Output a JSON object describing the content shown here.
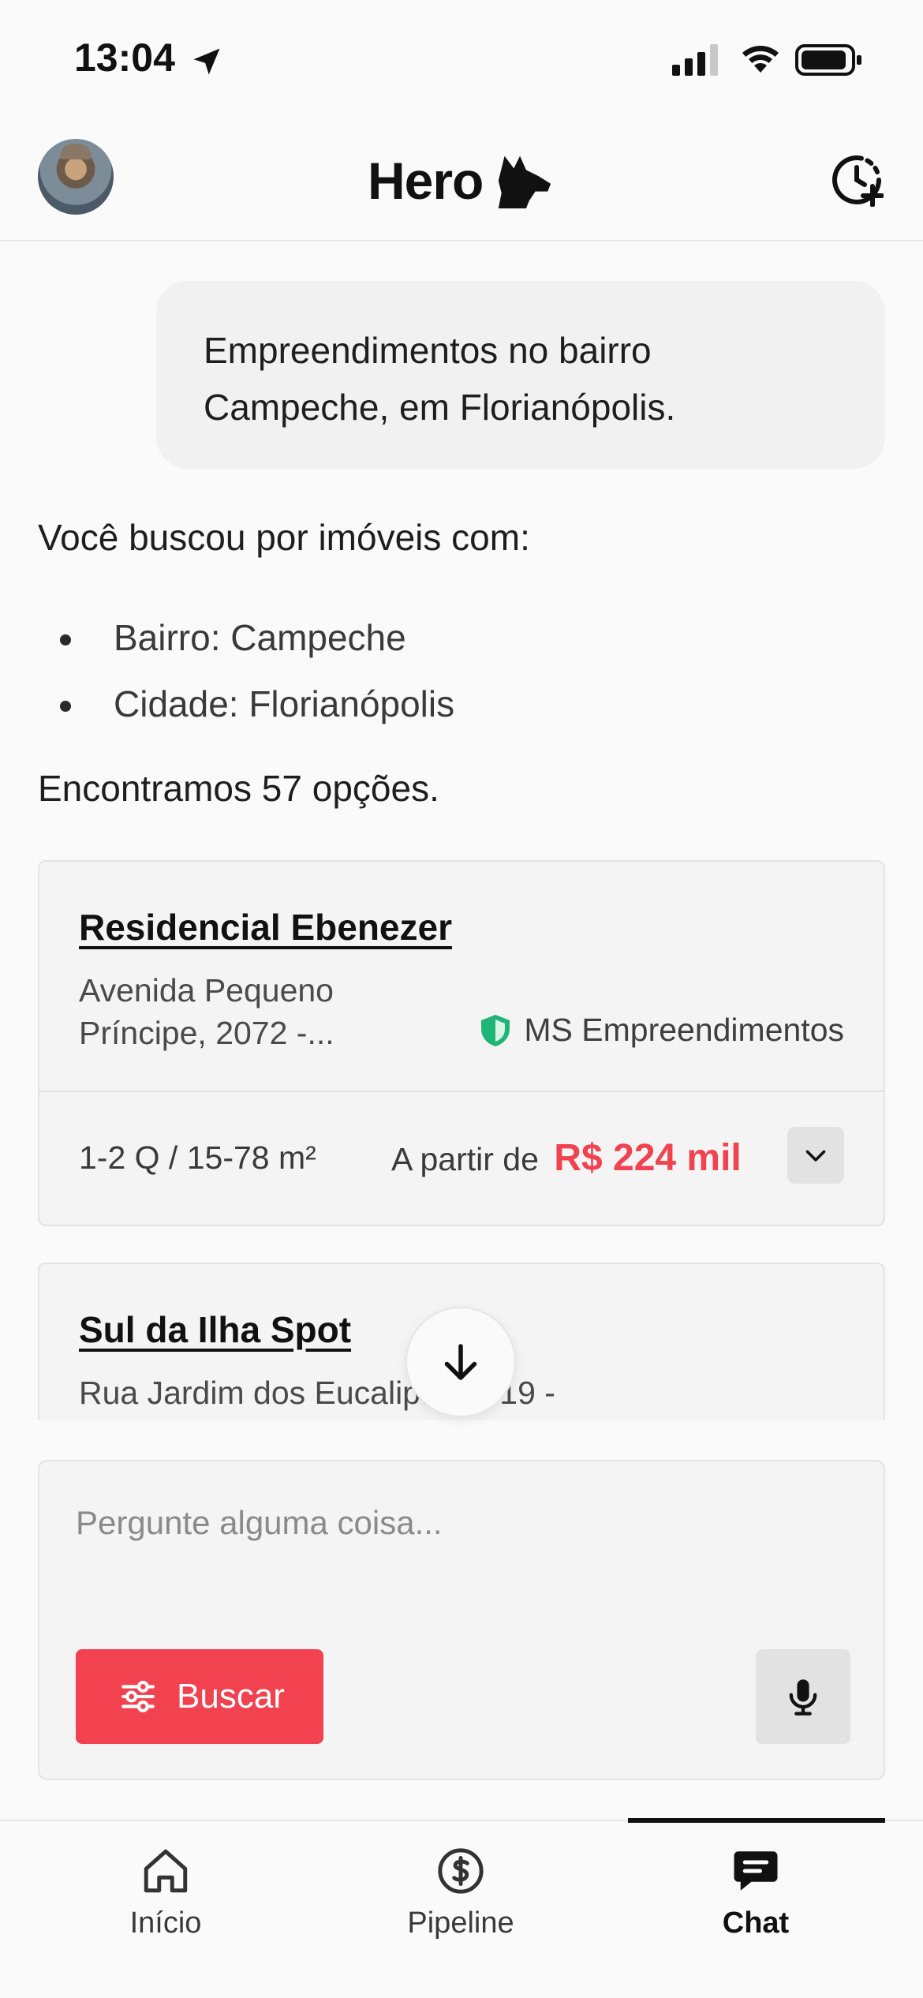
{
  "status_bar": {
    "time": "13:04"
  },
  "header": {
    "logo_text": "Hero"
  },
  "chat": {
    "user_message": "Empreendimentos no bairro Campeche, em Florianópolis.",
    "reply_intro": "Você buscou por imóveis com:",
    "criteria": [
      "Bairro: Campeche",
      "Cidade: Florianópolis"
    ],
    "result_count": "Encontramos 57 opções."
  },
  "listings": [
    {
      "title": "Residencial Ebenezer",
      "address": "Avenida Pequeno Príncipe, 2072 -...",
      "builder": "MS Empreendimentos",
      "size": "1-2 Q / 15-78 m²",
      "price_prefix": "A partir de",
      "price": "R$ 224 mil"
    },
    {
      "title": "Sul da Ilha Spot",
      "address": "Rua Jardim dos Eucaliptos, 619 -"
    }
  ],
  "composer": {
    "placeholder": "Pergunte alguma coisa...",
    "search_label": "Buscar"
  },
  "nav": {
    "items": [
      {
        "label": "Início",
        "icon": "home-icon",
        "active": false
      },
      {
        "label": "Pipeline",
        "icon": "dollar-circle-icon",
        "active": false
      },
      {
        "label": "Chat",
        "icon": "chat-icon",
        "active": true
      }
    ]
  },
  "colors": {
    "accent": "#f2424f",
    "price": "#f0434f",
    "verified": "#1fb577"
  }
}
